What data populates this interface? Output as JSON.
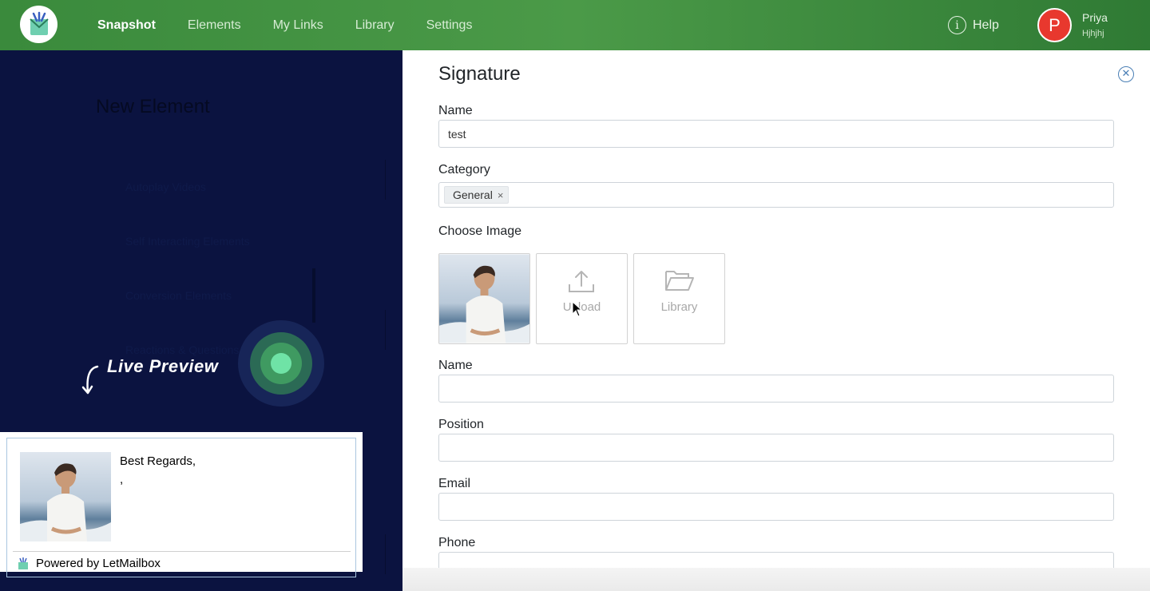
{
  "nav": {
    "items": [
      "Snapshot",
      "Elements",
      "My Links",
      "Library",
      "Settings"
    ],
    "active": "Snapshot",
    "help_label": "Help",
    "help_icon": "i",
    "user": {
      "initial": "P",
      "name": "Priya",
      "subtitle": "Hjhjhj"
    },
    "colors": {
      "bar": "#3f8f40",
      "avatar": "#e8382e"
    }
  },
  "background_page": {
    "title": "New Element",
    "menu": [
      "Autoplay Videos",
      "Self Interacting Elements",
      "Conversion Elements",
      "Reactions & Questions"
    ]
  },
  "live_preview": {
    "label": "Live Preview",
    "regards": "Best Regards,",
    "name_line": ",",
    "powered_by": "Powered by LetMailbox"
  },
  "form": {
    "title": "Signature",
    "name_label": "Name",
    "name_value": "test",
    "category_label": "Category",
    "category_tag": "General",
    "choose_image_label": "Choose Image",
    "upload_label": "Upload",
    "library_label": "Library",
    "sig_name_label": "Name",
    "position_label": "Position",
    "email_label": "Email",
    "phone_label": "Phone"
  }
}
